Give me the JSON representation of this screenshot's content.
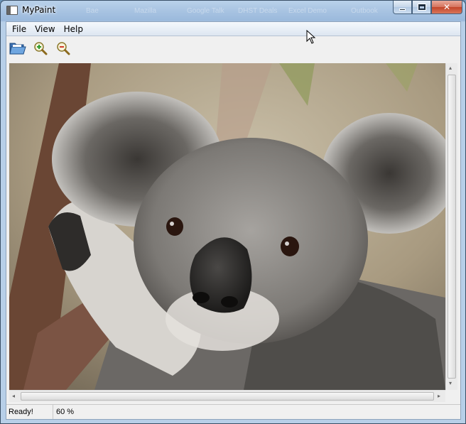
{
  "window": {
    "title": "MyPaint",
    "ghost_text": [
      "Bae",
      "Mazilla",
      "Google Talk",
      "DHST Deals",
      "Excel Demo",
      "Outbook"
    ]
  },
  "caption_buttons": {
    "minimize": "minimize",
    "maximize": "maximize",
    "close": "✕"
  },
  "menubar": {
    "items": [
      "File",
      "View",
      "Help"
    ]
  },
  "toolbar": {
    "buttons": [
      {
        "name": "open-folder-icon",
        "tooltip": ""
      },
      {
        "name": "zoom-in-icon",
        "tooltip": ""
      },
      {
        "name": "zoom-out-icon",
        "tooltip": ""
      }
    ]
  },
  "canvas": {
    "subject": "koala photograph",
    "zoom_percent": 60
  },
  "scroll": {
    "left_arrow": "◂",
    "right_arrow": "▸",
    "up_arrow": "▴",
    "down_arrow": "▾"
  },
  "statusbar": {
    "message": "Ready!",
    "zoom": "60 %"
  },
  "colors": {
    "title_bar": "#a9c4e2",
    "close_button": "#c3452a",
    "client_bg": "#f0f0f0"
  }
}
